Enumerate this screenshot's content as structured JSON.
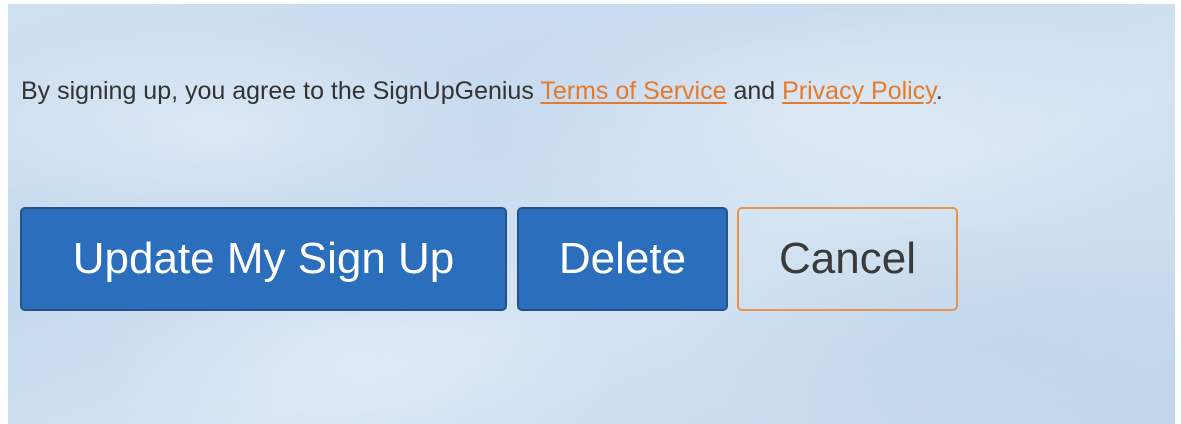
{
  "agreement": {
    "prefix": "By signing up, you agree to the SignUpGenius ",
    "terms_link": "Terms of Service",
    "conjunction": " and ",
    "privacy_link": "Privacy Policy",
    "suffix": "."
  },
  "buttons": {
    "update_label": "Update My Sign Up",
    "delete_label": "Delete",
    "cancel_label": "Cancel"
  },
  "colors": {
    "primary": "#2b6fbc",
    "link": "#e47a2b",
    "cancel_border": "#e4944f",
    "background": "#cfe0f1"
  }
}
